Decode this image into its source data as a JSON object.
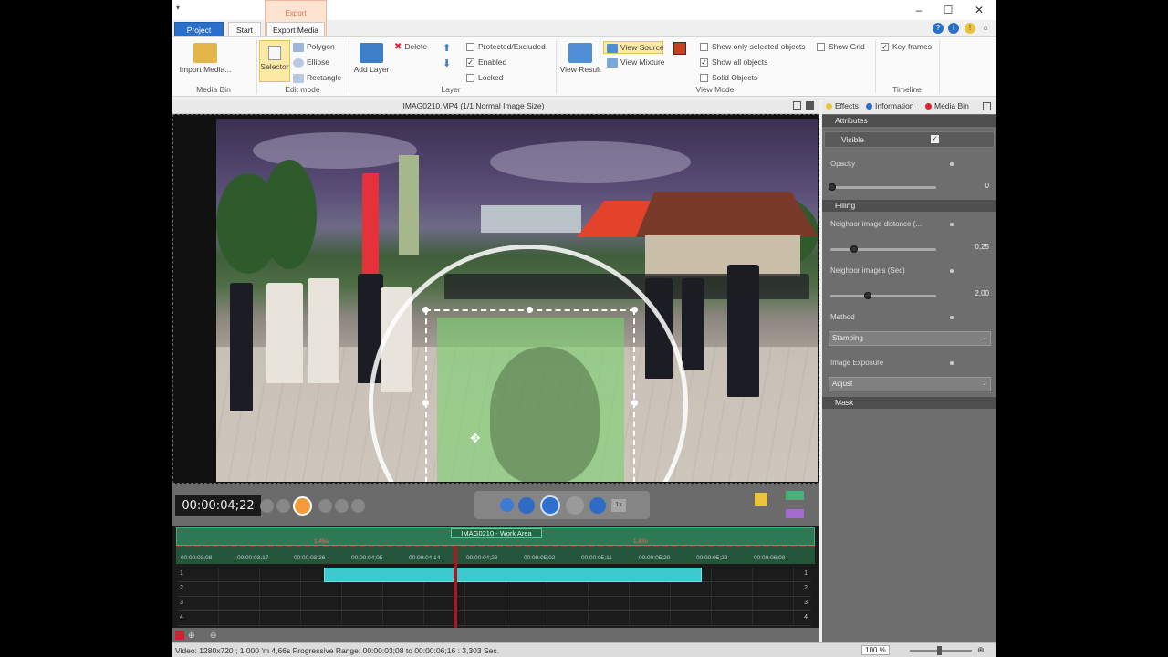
{
  "tabs": {
    "project": "Project",
    "start": "Start",
    "export": "Export Media",
    "context": "Export"
  },
  "ribbon": {
    "media_bin": {
      "import": "Import Media...",
      "label": "Media Bin"
    },
    "edit_mode": {
      "selector": "Selector",
      "polygon": "Polygon",
      "ellipse": "Ellipse",
      "rectangle": "Rectangle",
      "label": "Edit mode"
    },
    "layer": {
      "add": "Add Layer",
      "delete": "Delete",
      "protected": "Protected/Excluded",
      "enabled": "Enabled",
      "locked": "Locked",
      "label": "Layer"
    },
    "view_mode": {
      "view_result": "View Result",
      "view_source": "View Source",
      "view_mixture": "View Mixture",
      "show_selected": "Show only selected objects",
      "show_all": "Show all objects",
      "solid": "Solid Objects",
      "show_grid": "Show Grid",
      "label": "View Mode"
    },
    "timeline": {
      "key_frames": "Key frames",
      "label": "Timeline"
    }
  },
  "preview": {
    "title": "IMAG0210.MP4   (1/1  Normal Image Size)"
  },
  "transport": {
    "timecode": "00:00:04;22",
    "speed": "1x"
  },
  "timeline": {
    "work_area": "IMAG0210 - Work Area",
    "marker_left": "1.45s",
    "marker_right": "1.83s",
    "ruler": [
      "00:00:03;08",
      "00:00:03;17",
      "00:00:03;26",
      "00:00:04;05",
      "00:00:04;14",
      "00:00:04;23",
      "00:00:05;02",
      "00:00:05;11",
      "00:00:05;20",
      "00:00:05;29",
      "00:00:06;08"
    ],
    "tracks": [
      "1",
      "2",
      "3",
      "4"
    ]
  },
  "status": {
    "text": "Video: 1280x720 ; 1,000   'm 4,66s  Progressive  Range: 00:00:03;08 to 00:00:06;16 : 3,303 Sec.",
    "zoom": "100 %"
  },
  "panel": {
    "tabs": {
      "effects": "Effects",
      "information": "Information",
      "media_bin": "Media Bin"
    },
    "attributes": "Attributes",
    "visible": "Visible",
    "opacity_label": "Opacity",
    "opacity_value": "0",
    "filling": "Filling",
    "neighbor_distance_label": "Neighbor image distance (...",
    "neighbor_distance_value": "0,25",
    "neighbor_images_label": "Neighbor images (Sec)",
    "neighbor_images_value": "2,00",
    "method_label": "Method",
    "method_value": "Stamping",
    "exposure_label": "Image Exposure",
    "exposure_value": "Adjust",
    "mask": "Mask"
  },
  "colors": {
    "accent": "#2a6fc9",
    "highlight": "#fde9a6",
    "clip": "#3ac9cf",
    "playhead": "#a31e22"
  }
}
